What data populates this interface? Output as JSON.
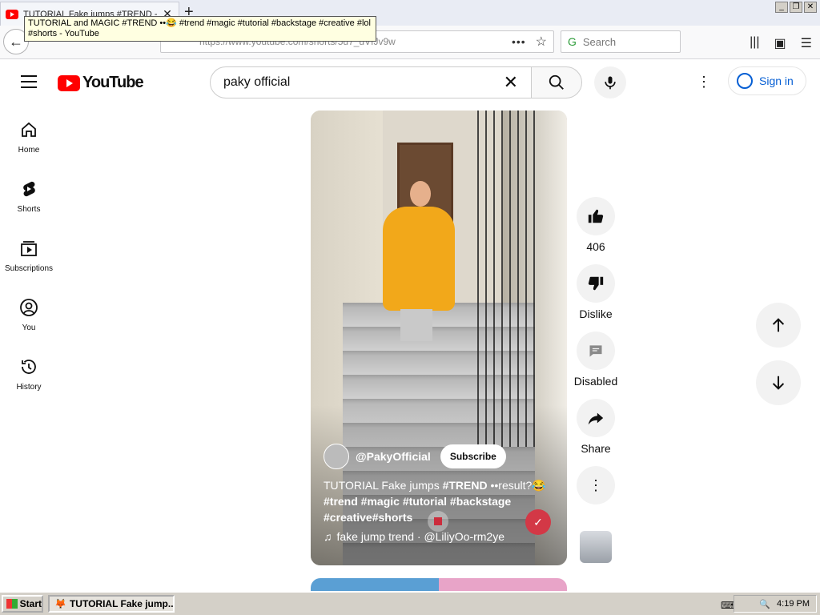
{
  "browser": {
    "tab_title": "TUTORIAL Fake jumps #TREND -",
    "tooltip": "TUTORIAL and MAGIC #TREND ••😂 #trend #magic #tutorial #backstage #creative #lol #shorts - YouTube",
    "url": "https://www.youtube.com/shorts/5u7_uVfJv9w",
    "search_placeholder": "Search"
  },
  "youtube": {
    "logo_text": "YouTube",
    "search_value": "paky official",
    "signin_label": "Sign in",
    "sidebar": [
      {
        "label": "Home",
        "icon": "home-icon"
      },
      {
        "label": "Shorts",
        "icon": "shorts-icon"
      },
      {
        "label": "Subscriptions",
        "icon": "subscriptions-icon"
      },
      {
        "label": "You",
        "icon": "you-icon"
      },
      {
        "label": "History",
        "icon": "history-icon"
      }
    ],
    "short": {
      "channel": "@PakyOfficial",
      "subscribe_label": "Subscribe",
      "caption_plain": "TUTORIAL Fake jumps ",
      "caption_bold1": "#TREND",
      "caption_rest": " ••result?😂",
      "caption_tags": "#trend #magic #tutorial #backstage #creative#shorts",
      "sound": "fake jump trend · @LiliyOo-rm2ye"
    },
    "actions": {
      "like_count": "406",
      "dislike_label": "Dislike",
      "comments_label": "Disabled",
      "share_label": "Share"
    }
  },
  "taskbar": {
    "start_label": "Start",
    "task_label": "TUTORIAL Fake jump...",
    "clock": "4:19 PM"
  }
}
